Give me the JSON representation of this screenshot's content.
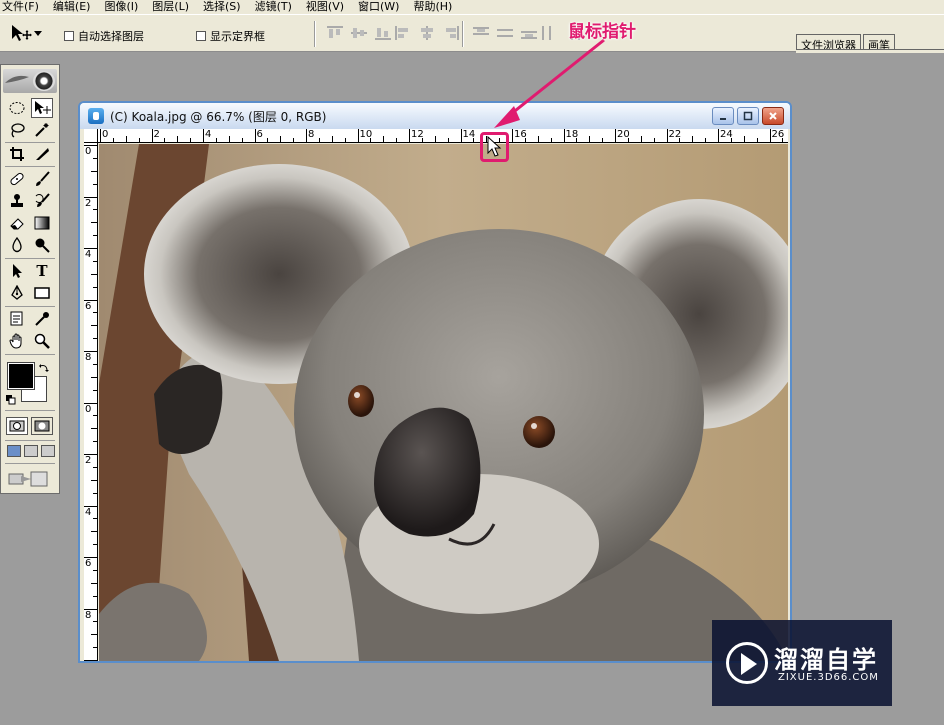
{
  "menubar": {
    "items": [
      "文件(F)",
      "编辑(E)",
      "图像(I)",
      "图层(L)",
      "选择(S)",
      "滤镜(T)",
      "视图(V)",
      "窗口(W)",
      "帮助(H)"
    ]
  },
  "options_bar": {
    "tool_icon": "move-tool-icon",
    "auto_select_layer": "自动选择图层",
    "show_bounding_box": "显示定界框",
    "auto_select_checked": false,
    "show_bbox_checked": false,
    "palette_tabs": [
      "文件浏览器",
      "画笔"
    ]
  },
  "toolbox": {
    "tools": [
      "marquee-tool-icon",
      "move-tool-icon",
      "lasso-tool-icon",
      "magic-wand-tool-icon",
      "crop-tool-icon",
      "slice-tool-icon",
      "healing-brush-tool-icon",
      "brush-tool-icon",
      "clone-stamp-tool-icon",
      "history-brush-tool-icon",
      "eraser-tool-icon",
      "gradient-tool-icon",
      "blur-tool-icon",
      "dodge-tool-icon",
      "path-selection-tool-icon",
      "type-tool-icon",
      "pen-tool-icon",
      "shape-tool-icon",
      "notes-tool-icon",
      "eyedropper-tool-icon",
      "hand-tool-icon",
      "zoom-tool-icon"
    ],
    "type_tool_glyph": "T",
    "foreground_color": "#000000",
    "background_color": "#ffffff"
  },
  "document": {
    "title": "(C) Koala.jpg @ 66.7% (图层 0, RGB)",
    "zoom": "66.7%",
    "h_ruler_labels": [
      "0",
      "2",
      "4",
      "6",
      "8",
      "10",
      "12",
      "14",
      "16",
      "18",
      "20",
      "22",
      "24",
      "26"
    ],
    "v_ruler_labels": [
      "0",
      "2",
      "4",
      "6",
      "8",
      "0",
      "2",
      "4",
      "6",
      "8",
      "2"
    ]
  },
  "annotation": {
    "label": "鼠标指针",
    "color": "#e01b6f"
  },
  "watermark": {
    "title": "溜溜自学",
    "subtitle": "ZIXUE.3D66.COM"
  }
}
